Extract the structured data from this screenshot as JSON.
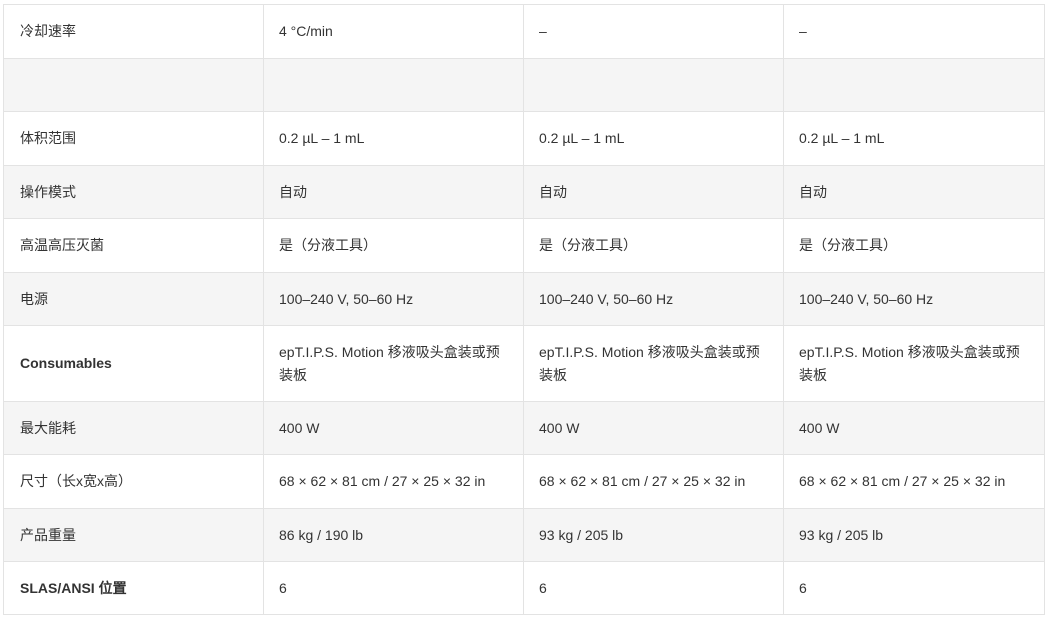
{
  "rows": [
    {
      "label": "冷却速率",
      "values": [
        "4 °C/min",
        "–",
        "–"
      ],
      "bold": false
    },
    {
      "label": "",
      "values": [
        "",
        "",
        ""
      ],
      "bold": false
    },
    {
      "label": "体积范围",
      "values": [
        "0.2 µL – 1 mL",
        "0.2 µL – 1 mL",
        "0.2 µL – 1 mL"
      ],
      "bold": false
    },
    {
      "label": "操作模式",
      "values": [
        "自动",
        "自动",
        "自动"
      ],
      "bold": false
    },
    {
      "label": "高温高压灭菌",
      "values": [
        "是（分液工具）",
        "是（分液工具）",
        "是（分液工具）"
      ],
      "bold": false
    },
    {
      "label": "电源",
      "values": [
        "100–240 V, 50–60 Hz",
        "100–240 V, 50–60 Hz",
        "100–240 V, 50–60 Hz"
      ],
      "bold": false
    },
    {
      "label": "Consumables",
      "values": [
        "epT.I.P.S. Motion 移液吸头盒装或预装板",
        "epT.I.P.S. Motion 移液吸头盒装或预装板",
        "epT.I.P.S. Motion 移液吸头盒装或预装板"
      ],
      "bold": true
    },
    {
      "label": "最大能耗",
      "values": [
        "400 W",
        "400 W",
        "400 W"
      ],
      "bold": false
    },
    {
      "label": "尺寸（长x宽x高）",
      "values": [
        "68 × 62 × 81 cm / 27 × 25 × 32 in",
        "68 × 62 × 81 cm / 27 × 25 × 32 in",
        "68 × 62 × 81 cm / 27 × 25 × 32 in"
      ],
      "bold": false
    },
    {
      "label": "产品重量",
      "values": [
        "86 kg / 190 lb",
        "93 kg / 205 lb",
        "93 kg / 205 lb"
      ],
      "bold": false
    },
    {
      "label": "SLAS/ANSI 位置",
      "values": [
        "6",
        "6",
        "6"
      ],
      "bold": false
    }
  ]
}
